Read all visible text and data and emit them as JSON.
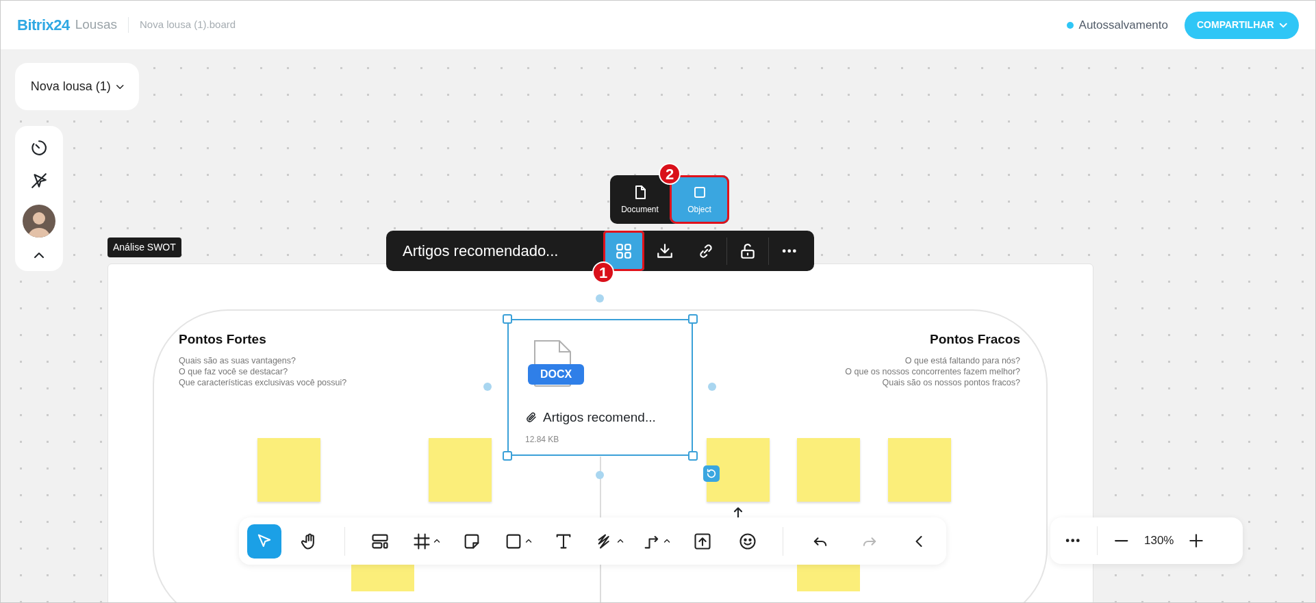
{
  "header": {
    "brand": "Bitrix24",
    "product": "Lousas",
    "file_name": "Nova lousa (1).board",
    "autosave": "Autossalvamento",
    "share_button": "COMPARTILHAR"
  },
  "board_menu": {
    "label": "Nova lousa (1)"
  },
  "frame_label": "Análise SWOT",
  "swot": [
    {
      "title": "Pontos Fortes",
      "lines": [
        "Quais são as suas vantagens?",
        "O que faz você se destacar?",
        "Que características exclusivas você possui?"
      ]
    },
    {
      "title": "Pontos Fracos",
      "lines": [
        "O que está faltando para nós?",
        "O que os nossos concorrentes fazem melhor?",
        "Quais são os nossos pontos fracos?"
      ]
    }
  ],
  "file_card": {
    "badge": "DOCX",
    "name": "Artigos recomend...",
    "size": "12.84 KB",
    "selected": true
  },
  "context_toolbar": {
    "title": "Artigos recomendado...",
    "action_groups": [
      [
        {
          "kind": "view",
          "selected": true
        },
        {
          "kind": "download",
          "selected": false
        },
        {
          "kind": "link",
          "selected": false
        }
      ],
      [
        {
          "kind": "unlock",
          "selected": false
        }
      ],
      [
        {
          "kind": "more",
          "selected": false
        }
      ]
    ]
  },
  "view_popover": [
    {
      "label": "Document",
      "kind": "document",
      "selected": false
    },
    {
      "label": "Object",
      "kind": "object",
      "selected": true
    }
  ],
  "callouts": [
    "1",
    "2"
  ],
  "tool_groups": [
    [
      {
        "kind": "select",
        "selected": true,
        "submenu": false
      },
      {
        "kind": "hand",
        "selected": false,
        "submenu": false
      }
    ],
    [
      {
        "kind": "layout",
        "selected": false,
        "submenu": false
      },
      {
        "kind": "frame",
        "selected": false,
        "submenu": true
      },
      {
        "kind": "sticky",
        "selected": false,
        "submenu": false
      },
      {
        "kind": "shape",
        "selected": false,
        "submenu": true
      },
      {
        "kind": "text",
        "selected": false,
        "submenu": false
      },
      {
        "kind": "pen",
        "selected": false,
        "submenu": true
      },
      {
        "kind": "connector",
        "selected": false,
        "submenu": true
      },
      {
        "kind": "upload",
        "selected": false,
        "submenu": false
      },
      {
        "kind": "emoji",
        "selected": false,
        "submenu": false
      }
    ],
    [
      {
        "kind": "undo",
        "disabled": false
      },
      {
        "kind": "redo",
        "disabled": true
      },
      {
        "kind": "collapse",
        "disabled": false
      }
    ]
  ],
  "zoom": {
    "value": "130%"
  }
}
